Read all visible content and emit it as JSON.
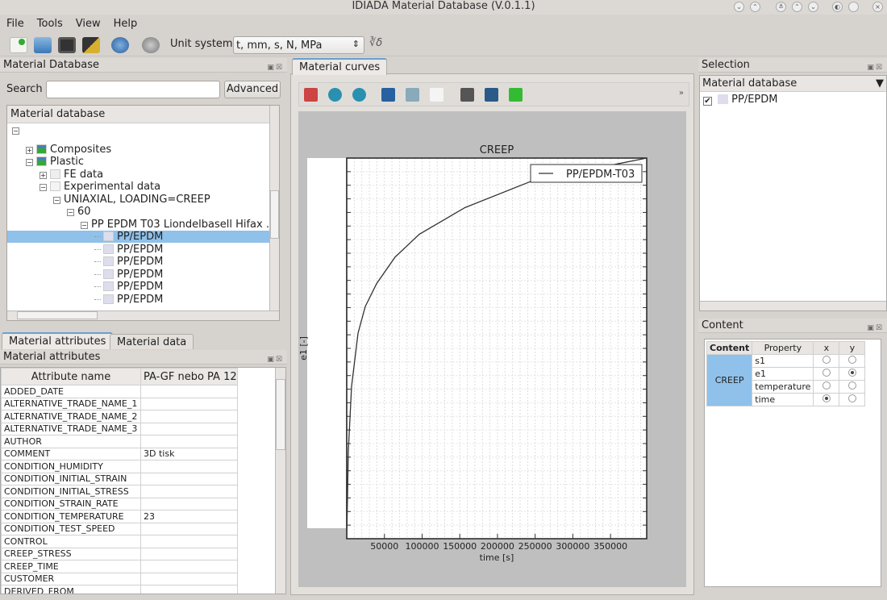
{
  "window": {
    "title": "IDIADA Material Database (V.0.1.1)",
    "controls": [
      "minimize",
      "maximize",
      "shade",
      "above",
      "below",
      "menu",
      "pin",
      "close"
    ]
  },
  "menu": [
    "File",
    "Tools",
    "View",
    "Help"
  ],
  "toolbar": {
    "icons": [
      "new-material-icon",
      "open-folder-icon",
      "save-icon",
      "edit-icon",
      "globe-icon",
      "update-icon"
    ],
    "unit_label": "Unit system",
    "unit_value": "t, mm, s, N, MPa",
    "formula_icon": "cube-root-icon"
  },
  "material_db": {
    "title": "Material Database",
    "search_label": "Search",
    "search_value": "",
    "advanced": "Advanced",
    "tree_header": "Material database",
    "tree": [
      {
        "label": "",
        "level": 0,
        "expander": "minus"
      },
      {
        "label": "Composites",
        "level": 1,
        "expander": "plus",
        "icon": "database-icon"
      },
      {
        "label": "Plastic",
        "level": 1,
        "expander": "minus",
        "icon": "database-icon"
      },
      {
        "label": "FE data",
        "level": 2,
        "expander": "plus",
        "icon": "table-icon"
      },
      {
        "label": "Experimental data",
        "level": 2,
        "expander": "minus",
        "icon": "curve-icon"
      },
      {
        "label": "UNIAXIAL, LOADING=CREEP",
        "level": 3,
        "expander": "minus"
      },
      {
        "label": "60",
        "level": 4,
        "expander": "minus"
      },
      {
        "label": "PP EPDM T03 Liondelbasell Hifax ...",
        "level": 5,
        "expander": "minus"
      },
      {
        "label": "PP/EPDM",
        "level": 6,
        "icon": "file-icon",
        "selected": true
      },
      {
        "label": "PP/EPDM",
        "level": 6,
        "icon": "file-icon"
      },
      {
        "label": "PP/EPDM",
        "level": 6,
        "icon": "file-icon"
      },
      {
        "label": "PP/EPDM",
        "level": 6,
        "icon": "file-icon"
      },
      {
        "label": "PP/EPDM",
        "level": 6,
        "icon": "file-icon"
      },
      {
        "label": "PP/EPDM",
        "level": 6,
        "icon": "file-icon"
      }
    ]
  },
  "bottom_tabs": [
    "Material attributes",
    "Material data"
  ],
  "attributes": {
    "title": "Material attributes",
    "columns": [
      "Attribute name",
      "PA-GF nebo PA 12"
    ],
    "rows": [
      [
        "ADDED_DATE",
        ""
      ],
      [
        "ALTERNATIVE_TRADE_NAME_1",
        ""
      ],
      [
        "ALTERNATIVE_TRADE_NAME_2",
        ""
      ],
      [
        "ALTERNATIVE_TRADE_NAME_3",
        ""
      ],
      [
        "AUTHOR",
        ""
      ],
      [
        "COMMENT",
        "3D tisk"
      ],
      [
        "CONDITION_HUMIDITY",
        ""
      ],
      [
        "CONDITION_INITIAL_STRAIN",
        ""
      ],
      [
        "CONDITION_INITIAL_STRESS",
        ""
      ],
      [
        "CONDITION_STRAIN_RATE",
        ""
      ],
      [
        "CONDITION_TEMPERATURE",
        "23"
      ],
      [
        "CONDITION_TEST_SPEED",
        ""
      ],
      [
        "CONTROL",
        ""
      ],
      [
        "CREEP_STRESS",
        ""
      ],
      [
        "CREEP_TIME",
        ""
      ],
      [
        "CUSTOMER",
        ""
      ],
      [
        "DERIVED_FROM",
        ""
      ]
    ]
  },
  "curves": {
    "tab": "Material curves",
    "tools": [
      "home-icon",
      "back-icon",
      "forward-icon",
      "pan-icon",
      "zoom-icon",
      "subplots-icon",
      "configure-icon",
      "save-icon",
      "check-icon"
    ],
    "more": "»"
  },
  "chart_data": {
    "type": "line",
    "title": "CREEP",
    "xlabel": "time [s]",
    "ylabel": "e1 [-]",
    "xlim": [
      0,
      398000
    ],
    "ylim": [
      0,
      1
    ],
    "grid": true,
    "legend": "top-right",
    "xticks": [
      50000,
      100000,
      150000,
      200000,
      250000,
      300000,
      350000
    ],
    "series": [
      {
        "name": "PP/EPDM-T03",
        "color": "#333333",
        "x": [
          0,
          2100,
          6400,
          15000,
          24600,
          39600,
          64200,
          96400,
          157000,
          246000,
          398000
        ],
        "y": [
          0,
          0.23,
          0.4,
          0.54,
          0.61,
          0.67,
          0.74,
          0.8,
          0.87,
          0.94,
          1.0
        ]
      }
    ]
  },
  "selection": {
    "title": "Selection",
    "header": "Material database",
    "items": [
      {
        "label": "PP/EPDM",
        "checked": true
      }
    ]
  },
  "content": {
    "title": "Content",
    "columns": [
      "Content",
      "Property",
      "x",
      "y"
    ],
    "group": "CREEP",
    "rows": [
      {
        "property": "s1",
        "x": false,
        "y": false
      },
      {
        "property": "e1",
        "x": false,
        "y": true
      },
      {
        "property": "temperature",
        "x": false,
        "y": false
      },
      {
        "property": "time",
        "x": true,
        "y": false
      }
    ]
  }
}
